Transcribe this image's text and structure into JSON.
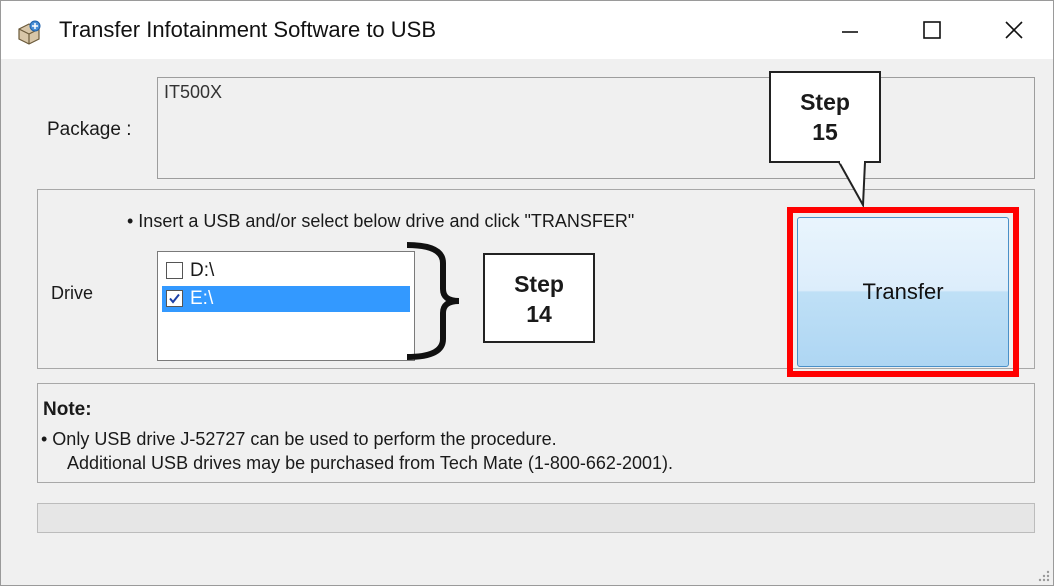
{
  "window": {
    "title": "Transfer Infotainment Software to USB",
    "icons": {
      "app": "software-package-icon",
      "minimize": "minimize-icon",
      "maximize": "maximize-icon",
      "close": "close-icon"
    }
  },
  "package": {
    "label": "Package :",
    "value": "IT500X"
  },
  "drive_group": {
    "instruction": "• Insert a USB and/or select below drive and click \"TRANSFER\"",
    "label": "Drive",
    "drives": [
      {
        "label": "D:\\",
        "checked": false,
        "selected": false
      },
      {
        "label": "E:\\",
        "checked": true,
        "selected": true
      }
    ]
  },
  "transfer_button": {
    "label": "Transfer"
  },
  "callouts": {
    "step14": {
      "line1": "Step",
      "line2": "14"
    },
    "step15": {
      "line1": "Step",
      "line2": "15"
    }
  },
  "highlight_color": "#ff0000",
  "selection_color": "#3399ff",
  "note": {
    "title": "Note:",
    "line1": "• Only USB drive J-52727 can be used to perform the procedure.",
    "line2": "Additional USB drives may be purchased from Tech Mate (1-800-662-2001)."
  },
  "progress": {
    "value": 0
  }
}
